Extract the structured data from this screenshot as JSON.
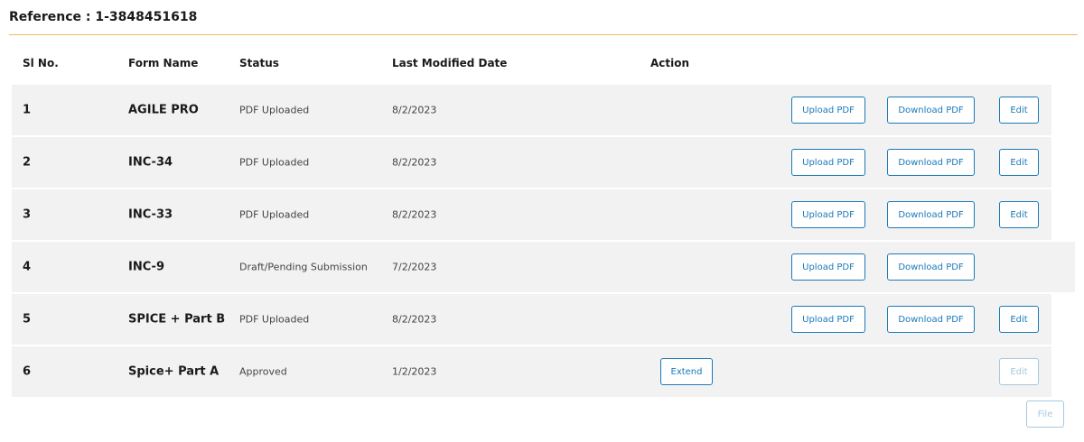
{
  "reference": {
    "label": "Reference : 1-3848451618"
  },
  "columns": {
    "sl": "Sl No.",
    "form": "Form Name",
    "status": "Status",
    "date": "Last Modified Date",
    "action": "Action"
  },
  "rows": [
    {
      "sl": "1",
      "form": "AGILE PRO",
      "status": "PDF Uploaded",
      "date": "8/2/2023",
      "upload": "Upload PDF",
      "download": "Download PDF",
      "edit": "Edit",
      "edit_disabled": false,
      "extend": null
    },
    {
      "sl": "2",
      "form": "INC-34",
      "status": "PDF Uploaded",
      "date": "8/2/2023",
      "upload": "Upload PDF",
      "download": "Download PDF",
      "edit": "Edit",
      "edit_disabled": false,
      "extend": null
    },
    {
      "sl": "3",
      "form": "INC-33",
      "status": "PDF Uploaded",
      "date": "8/2/2023",
      "upload": "Upload PDF",
      "download": "Download PDF",
      "edit": "Edit",
      "edit_disabled": false,
      "extend": null
    },
    {
      "sl": "4",
      "form": "INC-9",
      "status": "Draft/Pending Submission",
      "date": "7/2/2023",
      "upload": "Upload PDF",
      "download": "Download PDF",
      "edit": null,
      "edit_disabled": false,
      "extend": null
    },
    {
      "sl": "5",
      "form": "SPICE + Part B",
      "status": "PDF Uploaded",
      "date": "8/2/2023",
      "upload": "Upload PDF",
      "download": "Download PDF",
      "edit": "Edit",
      "edit_disabled": false,
      "extend": null
    },
    {
      "sl": "6",
      "form": "Spice+ Part A",
      "status": "Approved",
      "date": "1/2/2023",
      "upload": null,
      "download": null,
      "edit": "Edit",
      "edit_disabled": true,
      "extend": "Extend"
    }
  ],
  "footer": {
    "file_label": "File"
  },
  "colors": {
    "accent": "#1a7ab8",
    "divider": "#f0b860",
    "row_bg": "#f2f2f2",
    "disabled": "#a6c8df"
  }
}
